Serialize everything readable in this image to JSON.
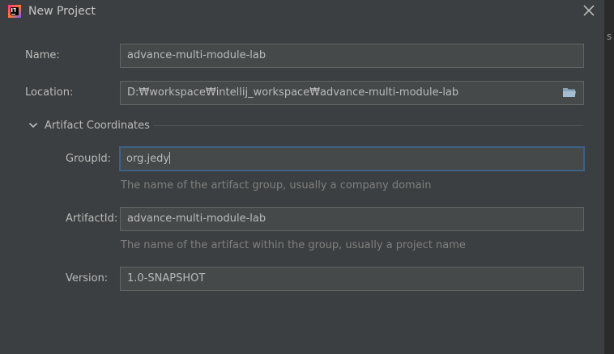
{
  "window": {
    "title": "New Project"
  },
  "edge_glyph": "s",
  "name_field": {
    "label": "Name:",
    "value": "advance-multi-module-lab"
  },
  "location_field": {
    "label": "Location:",
    "value": "D:₩workspace₩intellij_workspace₩advance-multi-module-lab"
  },
  "artifact_section": {
    "title": "Artifact Coordinates",
    "expanded": true
  },
  "group_id": {
    "label": "GroupId:",
    "value": "org.jedy",
    "hint": "The name of the artifact group, usually a company domain"
  },
  "artifact_id": {
    "label": "ArtifactId:",
    "value": "advance-multi-module-lab",
    "hint": "The name of the artifact within the group, usually a project name"
  },
  "version": {
    "label": "Version:",
    "value": "1.0-SNAPSHOT"
  },
  "icons": {
    "app": "intellij-icon",
    "close": "close-icon",
    "browse": "folder-icon",
    "toggle": "chevron-down-icon"
  },
  "colors": {
    "background": "#3c3f41",
    "field_bg": "#45494a",
    "field_border": "#646464",
    "focus_border": "#3d6185",
    "text": "#bbbbbb",
    "hint": "#7f7f7f",
    "folder": "#a5bdd1"
  }
}
